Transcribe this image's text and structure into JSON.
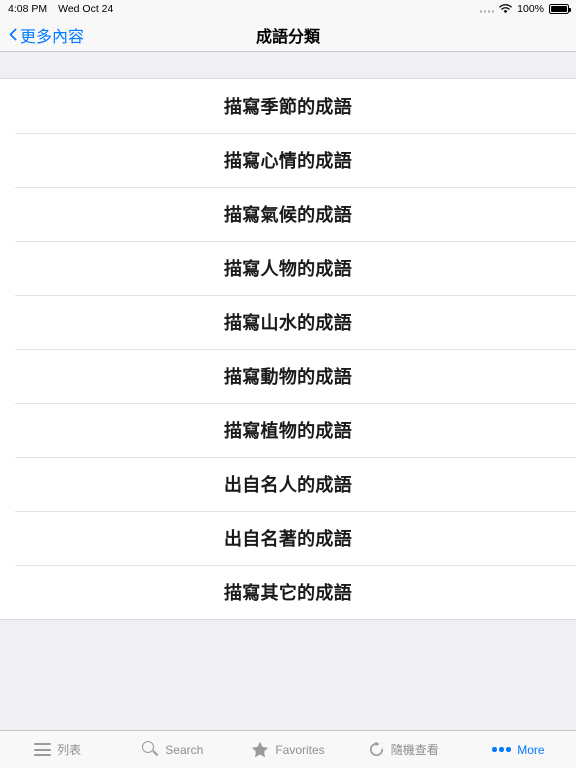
{
  "status_bar": {
    "time": "4:08 PM",
    "date": "Wed Oct 24",
    "battery_percent": "100%",
    "signal_icon": "signal-dots-icon",
    "wifi_icon": "wifi-icon",
    "battery_icon": "battery-full-icon"
  },
  "nav": {
    "back_label": "更多內容",
    "back_icon": "chevron-left-icon",
    "title": "成語分類"
  },
  "list": {
    "rows": [
      {
        "label": "描寫季節的成語"
      },
      {
        "label": "描寫心情的成語"
      },
      {
        "label": "描寫氣候的成語"
      },
      {
        "label": "描寫人物的成語"
      },
      {
        "label": "描寫山水的成語"
      },
      {
        "label": "描寫動物的成語"
      },
      {
        "label": "描寫植物的成語"
      },
      {
        "label": "出自名人的成語"
      },
      {
        "label": "出自名著的成語"
      },
      {
        "label": "描寫其它的成語"
      }
    ]
  },
  "tabbar": {
    "items": [
      {
        "label": "列表",
        "icon": "list-icon",
        "active": false
      },
      {
        "label": "Search",
        "icon": "search-icon",
        "active": false
      },
      {
        "label": "Favorites",
        "icon": "star-icon",
        "active": false
      },
      {
        "label": "隨機查看",
        "icon": "refresh-icon",
        "active": false
      },
      {
        "label": "More",
        "icon": "ellipsis-icon",
        "active": true
      }
    ]
  },
  "colors": {
    "accent": "#007aff",
    "inactive": "#8e8e93",
    "group_background": "#efeff4",
    "bar_background": "#f8f8f8",
    "separator": "#c8c7cc"
  }
}
